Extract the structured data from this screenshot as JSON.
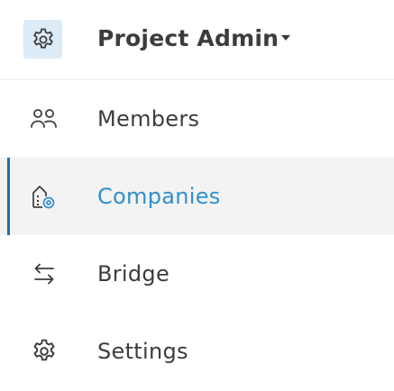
{
  "header": {
    "title": "Project Admin",
    "icon": "gear-icon",
    "caret_icon": "caret-down-icon"
  },
  "nav": {
    "items": [
      {
        "label": "Members",
        "icon": "members-icon",
        "active": false
      },
      {
        "label": "Companies",
        "icon": "companies-icon",
        "active": true
      },
      {
        "label": "Bridge",
        "icon": "bridge-icon",
        "active": false
      },
      {
        "label": "Settings",
        "icon": "gear-icon",
        "active": false
      }
    ]
  },
  "colors": {
    "text": "#3c3c3c",
    "active_text": "#2f8fce",
    "active_bar": "#1f6fb2",
    "active_bg": "#f3f3f3",
    "header_icon_bg": "#dcebf6"
  }
}
